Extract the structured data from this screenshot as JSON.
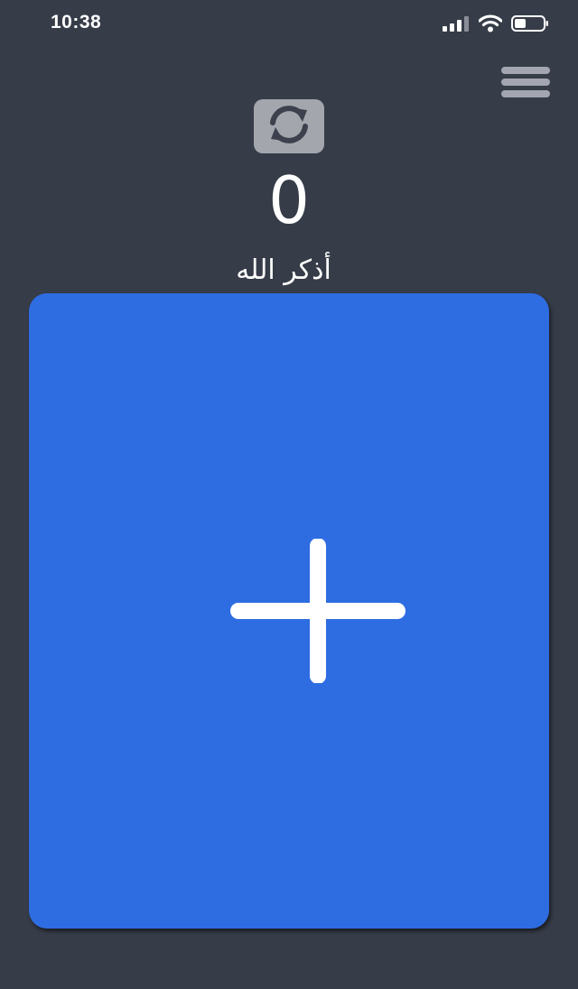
{
  "status_bar": {
    "time": "10:38",
    "icons": [
      "cellular-signal-icon",
      "wifi-icon",
      "battery-icon"
    ]
  },
  "header": {
    "menu_icon": "hamburger-menu-icon",
    "reset_icon": "refresh-icon"
  },
  "counter": {
    "value": "0"
  },
  "dhikr": {
    "text": "أذكر الله"
  },
  "tap_area": {
    "icon": "plus-icon",
    "color": "#2e6de1"
  },
  "colors": {
    "background": "#363c48",
    "accent": "#2e6de1",
    "control_gray": "#a4a6ad"
  }
}
